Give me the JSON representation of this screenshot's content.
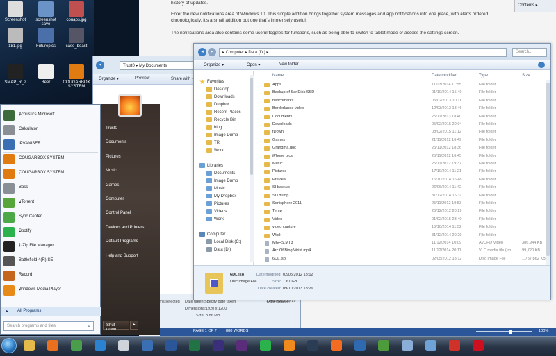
{
  "colors": {
    "accent": "#2b579a",
    "folder": "#e6b94b",
    "startmenu_right": "#3a2f2a",
    "taskbar": "#2a3647"
  },
  "desktop": {
    "icons": [
      {
        "label": "Screenshot",
        "icon": "image-icon"
      },
      {
        "label": "screenshot save",
        "icon": "image-icon"
      },
      {
        "label": "couaps.jpg",
        "icon": "image-icon"
      },
      {
        "label": "181.jpg",
        "icon": "image-icon"
      },
      {
        "label": "Futurepics",
        "icon": "folder-icon"
      },
      {
        "label": "case_beast",
        "icon": "image-icon"
      },
      {
        "label": "SMAP_R_2",
        "icon": "file-icon"
      },
      {
        "label": "Beer",
        "icon": "file-icon"
      },
      {
        "label": "COUGARBOX SYSTEM",
        "icon": "app-icon"
      }
    ]
  },
  "document": {
    "paragraph1": "history of updates.",
    "paragraph2": "Enter the new notifications area of Windows 10. This simple addition brings together system messages and app notifications into one place, with alerts ordered chronologically. It's a small addition but one that's immensely useful.",
    "paragraph3": "The notifications area also contains some useful toggles for functions, such as being able to switch to tablet mode or access the settings screen.",
    "right_tool_label": "Contents ▸"
  },
  "back_explorer": {
    "address": "Trust0 ▸ My Documents",
    "toolbar": {
      "organize": "Organize ▾",
      "preview": "Preview",
      "share": "Share with ▾"
    },
    "status": {
      "selected": "1 items selected",
      "date_taken_label": "Date taken:",
      "date_taken_value": "Specify date taken",
      "date_created_label": "Date created:",
      "date_created_value": "11/01/2013 19:19",
      "dimensions_label": "Dimensions:",
      "dimensions_value": "1920 x 1200",
      "size_label": "Size:",
      "size_value": "8.86 MB"
    }
  },
  "front_explorer": {
    "address": "▸ Computer ▸ Data (D:) ▸",
    "search_placeholder": "Search...",
    "toolbar": {
      "organize": "Organize ▾",
      "open": "Open ▾",
      "new_folder": "New folder"
    },
    "nav": [
      {
        "label": "Favorites",
        "icon": "star",
        "indent": 0
      },
      {
        "label": "Desktop",
        "icon": "fold",
        "indent": 1
      },
      {
        "label": "Downloads",
        "icon": "fold",
        "indent": 1
      },
      {
        "label": "Dropbox",
        "icon": "fold",
        "indent": 1
      },
      {
        "label": "Recent Places",
        "icon": "fold",
        "indent": 1
      },
      {
        "label": "Recycle Bin",
        "icon": "fold",
        "indent": 1
      },
      {
        "label": "blog",
        "icon": "fold",
        "indent": 1
      },
      {
        "label": "Image Dump",
        "icon": "fold",
        "indent": 1
      },
      {
        "label": "TR",
        "icon": "fold",
        "indent": 1
      },
      {
        "label": "Work",
        "icon": "fold",
        "indent": 1
      },
      {
        "label": "",
        "icon": "",
        "indent": 0
      },
      {
        "label": "Libraries",
        "icon": "lib",
        "indent": 0
      },
      {
        "label": "Documents",
        "icon": "lib",
        "indent": 1
      },
      {
        "label": "Image Dump",
        "icon": "lib",
        "indent": 1
      },
      {
        "label": "Music",
        "icon": "lib",
        "indent": 1
      },
      {
        "label": "My Dropbox",
        "icon": "lib",
        "indent": 1
      },
      {
        "label": "Pictures",
        "icon": "lib",
        "indent": 1
      },
      {
        "label": "Videos",
        "icon": "lib",
        "indent": 1
      },
      {
        "label": "Work",
        "icon": "lib",
        "indent": 1
      },
      {
        "label": "",
        "icon": "",
        "indent": 0
      },
      {
        "label": "Computer",
        "icon": "comp",
        "indent": 0
      },
      {
        "label": "Local Disk (C:)",
        "icon": "drive",
        "indent": 1
      },
      {
        "label": "Data (D:)",
        "icon": "drive",
        "indent": 1
      }
    ],
    "columns": {
      "name": "Name",
      "date": "Date modified",
      "type": "Type",
      "size": "Size"
    },
    "files": [
      {
        "name": "Apps",
        "date": "11/03/2014 11:55",
        "type": "File folder",
        "size": "",
        "kind": "folder"
      },
      {
        "name": "Backup of SanDisk SSD",
        "date": "01/10/2014 15:49",
        "type": "File folder",
        "size": "",
        "kind": "folder"
      },
      {
        "name": "benchmarks",
        "date": "05/02/2013 10:11",
        "type": "File folder",
        "size": "",
        "kind": "folder"
      },
      {
        "name": "Borderlands video",
        "date": "12/03/2013 13:46",
        "type": "File folder",
        "size": "",
        "kind": "folder"
      },
      {
        "name": "Documents",
        "date": "25/11/2013 18:40",
        "type": "File folder",
        "size": "",
        "kind": "folder"
      },
      {
        "name": "Downloads",
        "date": "05/02/2015 20:04",
        "type": "File folder",
        "size": "",
        "kind": "folder"
      },
      {
        "name": "fDown",
        "date": "08/02/2015 11:12",
        "type": "File folder",
        "size": "",
        "kind": "folder"
      },
      {
        "name": "Games",
        "date": "21/11/2012 16:49",
        "type": "File folder",
        "size": "",
        "kind": "folder"
      },
      {
        "name": "Grandma.doc",
        "date": "25/11/2012 18:36",
        "type": "File folder",
        "size": "",
        "kind": "folder"
      },
      {
        "name": "iPhone pics",
        "date": "25/11/2012 16:45",
        "type": "File folder",
        "size": "",
        "kind": "folder"
      },
      {
        "name": "Music",
        "date": "25/11/2012 19:37",
        "type": "File folder",
        "size": "",
        "kind": "folder"
      },
      {
        "name": "Pictures",
        "date": "17/10/2014 11:21",
        "type": "File folder",
        "size": "",
        "kind": "folder"
      },
      {
        "name": "Preview",
        "date": "16/10/2014 16:48",
        "type": "File folder",
        "size": "",
        "kind": "folder"
      },
      {
        "name": "SI backup",
        "date": "26/06/2014 11:42",
        "type": "File folder",
        "size": "",
        "kind": "folder"
      },
      {
        "name": "SD dump",
        "date": "31/12/2014 15:31",
        "type": "File folder",
        "size": "",
        "kind": "folder"
      },
      {
        "name": "Sonisphere 2011",
        "date": "25/11/2012 19:53",
        "type": "File folder",
        "size": "",
        "kind": "folder"
      },
      {
        "name": "Temp",
        "date": "25/12/2012 20:29",
        "type": "File folder",
        "size": "",
        "kind": "folder"
      },
      {
        "name": "Video",
        "date": "01/02/2015 23:40",
        "type": "File folder",
        "size": "",
        "kind": "folder"
      },
      {
        "name": "video capture",
        "date": "15/10/2014 11:52",
        "type": "File folder",
        "size": "",
        "kind": "folder"
      },
      {
        "name": "Work",
        "date": "31/12/2014 20:29",
        "type": "File folder",
        "size": "",
        "kind": "folder"
      },
      {
        "name": "MGHS.MT3",
        "date": "11/12/2014 10:09",
        "type": "AVCHD Video",
        "size": "386,944 KB",
        "kind": "file"
      },
      {
        "name": "Arc Of Bing Wrist.mp4",
        "date": "11/12/2014 20:11",
        "type": "VLC media file (.m...",
        "size": "99,720 KB",
        "kind": "file"
      },
      {
        "name": "6DL.iso",
        "date": "02/05/2012 18:12",
        "type": "Disc Image File",
        "size": "1,757,862 KB",
        "kind": "file"
      }
    ],
    "details": {
      "filename": "6DL.iso",
      "filetype": "Disc Image File",
      "modified_label": "Date modified:",
      "modified_value": "02/05/2012 18:12",
      "size_label": "Size:",
      "size_value": "1.67 GB",
      "created_label": "Date created:",
      "created_value": "09/10/2013 18:26"
    }
  },
  "start_menu": {
    "items": [
      {
        "label": "Acoustics Microsoft",
        "color": "#3d6a3a",
        "arrow": "▸"
      },
      {
        "label": "Calculator",
        "color": "#8a8f96",
        "arrow": ""
      },
      {
        "label": "IPVANISER",
        "color": "#3a6fb4",
        "arrow": ""
      },
      {
        "label": "COUGARBOX SYSTEM",
        "color": "#e07b12",
        "arrow": ""
      },
      {
        "label": "COUGARBOX SYSTEM",
        "color": "#e07b12",
        "arrow": "▸"
      },
      {
        "label": "Boss",
        "color": "#8a8f96",
        "arrow": ""
      },
      {
        "label": "uTorrent",
        "color": "#58a53b",
        "arrow": "▸"
      },
      {
        "label": "Sync Center",
        "color": "#4da848",
        "arrow": ""
      },
      {
        "label": "Spotify",
        "color": "#2bb24c",
        "arrow": "▸"
      },
      {
        "label": "1-Zip File Manager",
        "color": "#222222",
        "arrow": "▸"
      },
      {
        "label": "Battlefield 4(R) SE",
        "color": "#555555",
        "arrow": ""
      },
      {
        "label": "Record",
        "color": "#c4661d",
        "arrow": ""
      },
      {
        "label": "Windows Media Player",
        "color": "#e88a1a",
        "arrow": "▸"
      }
    ],
    "all_programs": "All Programs",
    "search_placeholder": "Search programs and files",
    "right": [
      "Trust0",
      "Documents",
      "Pictures",
      "Music",
      "Games",
      "Computer",
      "Control Panel",
      "Devices and Printers",
      "Default Programs",
      "Help and Support"
    ],
    "shutdown": "Shut down"
  },
  "word_status": {
    "page": "PAGE 1 OF 7",
    "words": "880 WORDS",
    "zoom": "100%"
  },
  "taskbar": {
    "apps": [
      {
        "name": "explorer",
        "color": "#e6b94b"
      },
      {
        "name": "firefox",
        "color": "#e8701e"
      },
      {
        "name": "chrome",
        "color": "#4a9d4a"
      },
      {
        "name": "internet-explorer",
        "color": "#2a82d0"
      },
      {
        "name": "alienware",
        "color": "#cfd4da"
      },
      {
        "name": "ds",
        "color": "#3a6fb4"
      },
      {
        "name": "word",
        "color": "#2b579a"
      },
      {
        "name": "excel",
        "color": "#217346"
      },
      {
        "name": "premiere",
        "color": "#3b2e7a"
      },
      {
        "name": "premiere2",
        "color": "#5a2c7a"
      },
      {
        "name": "spotify",
        "color": "#2bb24c"
      },
      {
        "name": "vlc",
        "color": "#f08a1c"
      },
      {
        "name": "steam",
        "color": "#2a3d55"
      },
      {
        "name": "origin",
        "color": "#f36c21"
      },
      {
        "name": "media-center",
        "color": "#2f6ab0"
      },
      {
        "name": "greenshot",
        "color": "#4d9b3a"
      },
      {
        "name": "notepad",
        "color": "#8aaed8"
      },
      {
        "name": "photos",
        "color": "#6fa2d6"
      },
      {
        "name": "vivaldi",
        "color": "#d0322a"
      },
      {
        "name": "opera",
        "color": "#cc1020"
      }
    ]
  }
}
